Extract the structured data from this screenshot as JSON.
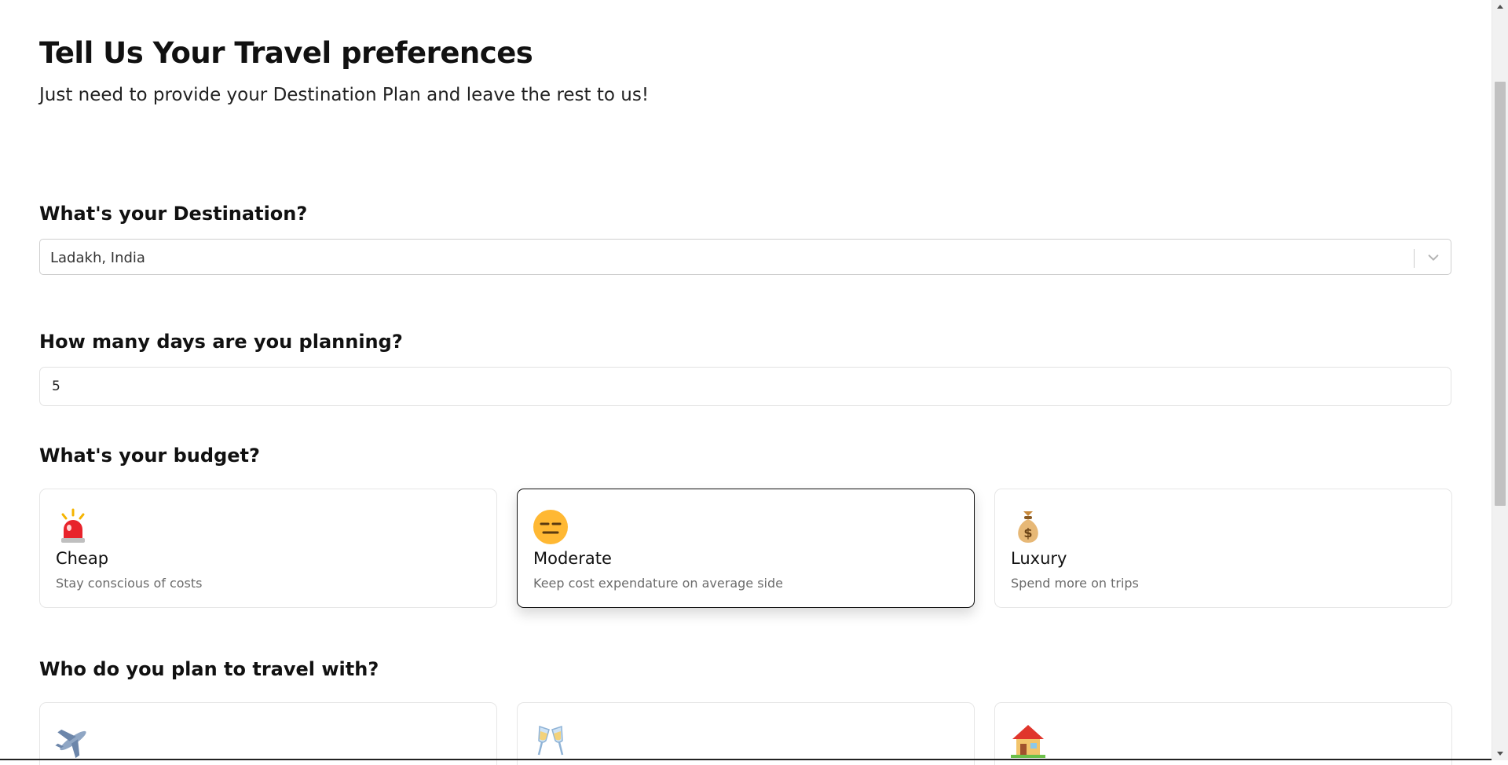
{
  "header": {
    "title": "Tell Us Your Travel preferences",
    "subtitle": "Just need to provide your Destination Plan and leave the rest to us!"
  },
  "destination": {
    "question": "What's your Destination?",
    "value": "Ladakh, India",
    "icon": "chevron-down-icon"
  },
  "days": {
    "question": "How many days are you planning?",
    "value": "5"
  },
  "budget": {
    "question": "What's your budget?",
    "selected": "Moderate",
    "options": [
      {
        "icon": "siren-icon",
        "title": "Cheap",
        "desc": "Stay conscious of costs"
      },
      {
        "icon": "expressionless-face-icon",
        "title": "Moderate",
        "desc": "Keep cost expendature on average side"
      },
      {
        "icon": "money-bag-icon",
        "title": "Luxury",
        "desc": "Spend more on trips"
      }
    ]
  },
  "travelers": {
    "question": "Who do you plan to travel with?",
    "options": [
      {
        "icon": "airplane-icon"
      },
      {
        "icon": "clinking-glasses-icon"
      },
      {
        "icon": "house-icon"
      }
    ]
  },
  "colors": {
    "selected_border": "#111111",
    "card_border": "#e6e6e6",
    "muted_text": "#6b6b6b"
  }
}
